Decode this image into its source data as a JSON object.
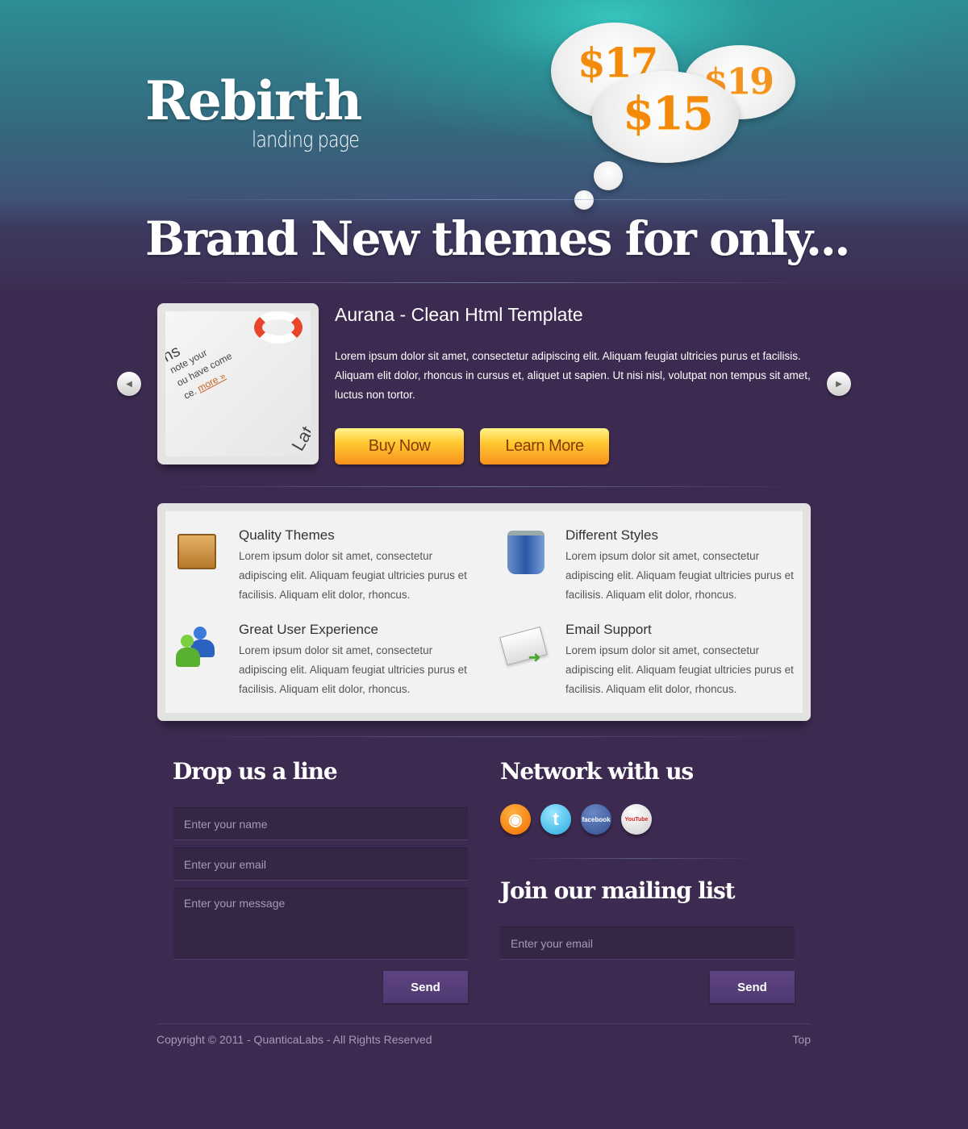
{
  "header": {
    "logo": "Rebirth",
    "tagline": "landing page",
    "prices": [
      "$17",
      "$19",
      "$15"
    ]
  },
  "headline": "Brand New themes for only...",
  "slider": {
    "title": "Aurana - Clean Html Template",
    "text": "Lorem ipsum dolor sit amet, consectetur adipiscing elit. Aliquam feugiat ultricies purus et facilisis. Aliquam elit dolor, rhoncus in cursus et, aliquet ut sapien. Ut nisi nisl, volutpat non tempus sit amet, luctus non tortor.",
    "buy_label": "Buy Now",
    "learn_label": "Learn More",
    "thumb_text": [
      "ns",
      "note your",
      "ou have come",
      "ce.",
      "more »",
      "Lat"
    ]
  },
  "features": [
    {
      "title": "Quality Themes",
      "text": "Lorem ipsum dolor sit amet, consectetur adipiscing elit. Aliquam feugiat ultricies purus et facilisis. Aliquam elit dolor, rhoncus.",
      "icon": "box-icon"
    },
    {
      "title": "Different Styles",
      "text": "Lorem ipsum dolor sit amet, consectetur adipiscing elit. Aliquam feugiat ultricies purus et facilisis. Aliquam elit dolor, rhoncus.",
      "icon": "paint-bucket-icon"
    },
    {
      "title": "Great User Experience",
      "text": "Lorem ipsum dolor sit amet, consectetur adipiscing elit. Aliquam feugiat ultricies purus et facilisis. Aliquam elit dolor, rhoncus.",
      "icon": "users-icon"
    },
    {
      "title": "Email Support",
      "text": "Lorem ipsum dolor sit amet, consectetur adipiscing elit. Aliquam feugiat ultricies purus et facilisis. Aliquam elit dolor, rhoncus.",
      "icon": "envelope-icon"
    }
  ],
  "contact": {
    "title": "Drop us a line",
    "name_placeholder": "Enter your name",
    "email_placeholder": "Enter your email",
    "message_placeholder": "Enter your message",
    "send_label": "Send"
  },
  "network": {
    "title": "Network with us",
    "facebook_label": "facebook",
    "youtube_label": "YouTube"
  },
  "mailing": {
    "title": "Join our mailing list",
    "email_placeholder": "Enter your email",
    "send_label": "Send"
  },
  "footer": {
    "copyright": "Copyright © 2011 - QuanticaLabs - All Rights Reserved",
    "top_link": "Top"
  },
  "colors": {
    "background": "#3d2a50",
    "accent_orange": "#f7921e",
    "button_purple": "#5e4482"
  }
}
